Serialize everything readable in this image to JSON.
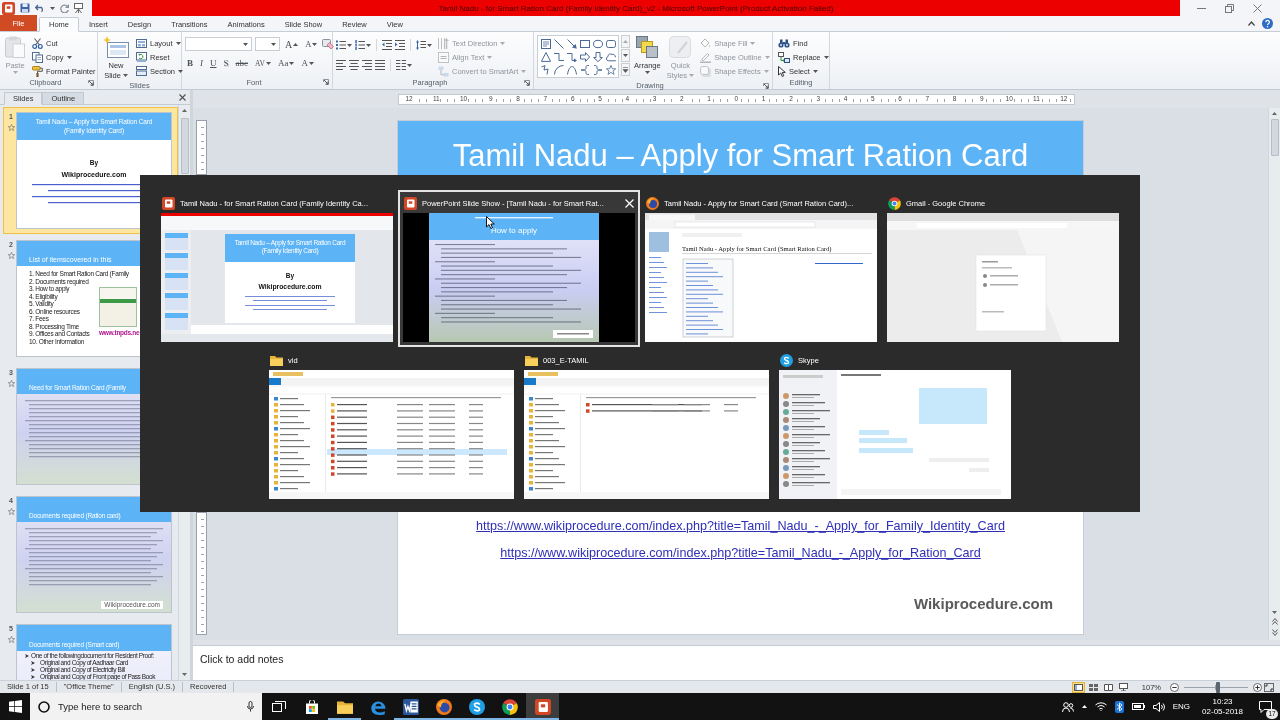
{
  "title_bar": {
    "title": "Tamil Nadu - for Smart Ration Card (Family Identity Card)_v2 - Microsoft PowerPoint (Product Activation Failed)"
  },
  "ribbon_tabs": [
    {
      "label": "File",
      "kind": "backstage",
      "selected": false
    },
    {
      "label": "Home",
      "kind": "tab",
      "selected": true
    },
    {
      "label": "Insert",
      "kind": "tab",
      "selected": false
    },
    {
      "label": "Design",
      "kind": "tab",
      "selected": false
    },
    {
      "label": "Transitions",
      "kind": "tab",
      "selected": false
    },
    {
      "label": "Animations",
      "kind": "tab",
      "selected": false
    },
    {
      "label": "Slide Show",
      "kind": "tab",
      "selected": false
    },
    {
      "label": "Review",
      "kind": "tab",
      "selected": false
    },
    {
      "label": "View",
      "kind": "tab",
      "selected": false
    }
  ],
  "ribbon_groups": [
    {
      "kind": "clipboard",
      "label": "Clipboard",
      "launcher": true,
      "large": [
        {
          "kind": "paste",
          "lines": [
            "Paste"
          ],
          "dropdown": true,
          "disabled": true
        }
      ],
      "commands": [
        {
          "kind": "cut",
          "label": "Cut",
          "dropdown": false,
          "disabled": false
        },
        {
          "kind": "copy",
          "label": "Copy",
          "dropdown": true,
          "disabled": false
        },
        {
          "kind": "painter",
          "label": "Format Painter",
          "dropdown": false,
          "disabled": false
        }
      ]
    },
    {
      "kind": "slides",
      "label": "Slides",
      "launcher": false,
      "large": [
        {
          "kind": "new-slide",
          "lines": [
            "New",
            "Slide"
          ],
          "dropdown": true,
          "disabled": false
        }
      ],
      "commands": [
        {
          "kind": "layout",
          "label": "Layout",
          "dropdown": true,
          "disabled": false
        },
        {
          "kind": "reset",
          "label": "Reset",
          "dropdown": false,
          "disabled": false
        },
        {
          "kind": "section",
          "label": "Section",
          "dropdown": true,
          "disabled": false
        }
      ]
    },
    {
      "kind": "font",
      "label": "Font",
      "launcher": true,
      "size_buttons": [
        {
          "kind": "grow",
          "label": "A"
        },
        {
          "kind": "shrink",
          "label": "A"
        }
      ],
      "format_buttons": [
        {
          "kind": "bold",
          "label": "B",
          "dropdown": false
        },
        {
          "kind": "italic",
          "label": "I",
          "dropdown": false
        },
        {
          "kind": "underline",
          "label": "U",
          "dropdown": false
        },
        {
          "kind": "shadow",
          "label": "S",
          "dropdown": false
        },
        {
          "kind": "strike",
          "label": "abc",
          "dropdown": false
        },
        {
          "kind": "spacing",
          "label": "AV",
          "dropdown": true
        },
        {
          "kind": "case",
          "label": "Aa",
          "dropdown": true
        },
        {
          "kind": "color",
          "label": "A",
          "dropdown": true
        }
      ]
    },
    {
      "kind": "paragraph",
      "label": "Paragraph",
      "launcher": true,
      "commands": [
        {
          "kind": "text-direction",
          "label": "Text Direction",
          "dropdown": true,
          "disabled": true
        },
        {
          "kind": "align-text",
          "label": "Align Text",
          "dropdown": true,
          "disabled": true
        },
        {
          "kind": "smartart",
          "label": "Convert to SmartArt",
          "dropdown": true,
          "disabled": true
        }
      ]
    },
    {
      "kind": "drawing",
      "label": "Drawing",
      "launcher": true,
      "large": [
        {
          "kind": "arrange",
          "lines": [
            "Arrange"
          ],
          "dropdown": true,
          "disabled": false
        },
        {
          "kind": "quick-styles",
          "lines": [
            "Quick",
            "Styles"
          ],
          "dropdown": true,
          "disabled": true
        }
      ],
      "commands": [
        {
          "kind": "shape-fill",
          "label": "Shape Fill",
          "dropdown": true,
          "disabled": true
        },
        {
          "kind": "shape-outline",
          "label": "Shape Outline",
          "dropdown": true,
          "disabled": true
        },
        {
          "kind": "shape-effects",
          "label": "Shape Effects",
          "dropdown": true,
          "disabled": true
        }
      ]
    },
    {
      "kind": "editing",
      "label": "Editing",
      "launcher": false,
      "commands": [
        {
          "kind": "find",
          "label": "Find",
          "dropdown": false,
          "disabled": false
        },
        {
          "kind": "replace",
          "label": "Replace",
          "dropdown": true,
          "disabled": false
        },
        {
          "kind": "select",
          "label": "Select",
          "dropdown": true,
          "disabled": false
        }
      ]
    }
  ],
  "slides_panel": {
    "tabs": [
      {
        "label": "Slides",
        "selected": true
      },
      {
        "label": "Outline",
        "selected": false
      }
    ],
    "slides": [
      {
        "number": "1",
        "selected": true,
        "kind": "title",
        "title_lines": [
          "Tamil Nadu – Apply for Smart Ration Card",
          "(Family Identity Card)"
        ],
        "by": "By",
        "site": "Wikiprocedure.com"
      },
      {
        "number": "2",
        "selected": false,
        "kind": "list",
        "title": "List of itemscovered in this",
        "items": [
          {
            "number": "1.",
            "text": "Need for Smart Ration Card (Family"
          },
          {
            "number": "2.",
            "text": "Documents required"
          },
          {
            "number": "3.",
            "text": "How to apply"
          },
          {
            "number": "4.",
            "text": "Eligibility"
          },
          {
            "number": "5.",
            "text": "Validity"
          },
          {
            "number": "6.",
            "text": "Online resources"
          },
          {
            "number": "7.",
            "text": "Fees"
          },
          {
            "number": "8.",
            "text": "Processing Time"
          },
          {
            "number": "9.",
            "text": "Offices and Contacts"
          },
          {
            "number": "10.",
            "text": "Other Information"
          }
        ],
        "link": "www.tnpds.ne"
      },
      {
        "number": "3",
        "selected": false,
        "kind": "text",
        "title": "Need for Smart Ration Card (Family"
      },
      {
        "number": "4",
        "selected": false,
        "kind": "text",
        "title": "Documents required (Ration card)",
        "footer": "Wikiprocedure.com"
      },
      {
        "number": "5",
        "selected": false,
        "kind": "bullets",
        "title": "Documents required (Smart card)",
        "bullets": [
          {
            "text": "One of the followingdocument for Resident Proof:",
            "children": [
              {
                "text": "Original and Copy of Aadhaar Card"
              },
              {
                "text": "Original and Copy of Electricity Bill"
              },
              {
                "text": "Original and Copy of Front page of Pass Book"
              }
            ]
          }
        ]
      }
    ]
  },
  "ruler": {
    "numbers": [
      "12",
      "11",
      "10",
      "9",
      "8",
      "7",
      "6",
      "5",
      "4",
      "3",
      "2",
      "1",
      "0",
      "1",
      "2",
      "3",
      "4",
      "5",
      "6",
      "7",
      "8",
      "9",
      "10",
      "11",
      "12"
    ]
  },
  "slide": {
    "title": "Tamil Nadu – Apply for Smart Ration Card",
    "links": [
      "https://www.wikiprocedure.com/index.php?title=Tamil_Nadu_-_Apply_for_Family_Identity_Card",
      "https://www.wikiprocedure.com/index.php?title=Tamil_Nadu_-_Apply_for_Ration_Card"
    ],
    "footer": "Wikiprocedure.com"
  },
  "notes": {
    "placeholder": "Click to add notes"
  },
  "status_bar": {
    "items": [
      "Slide 1 of 15",
      "\"Office Theme\"",
      "English (U.S.)",
      "Recovered"
    ],
    "views": [
      {
        "kind": "normal",
        "selected": true
      },
      {
        "kind": "sorter",
        "selected": false
      },
      {
        "kind": "reading",
        "selected": false
      },
      {
        "kind": "slideshow",
        "selected": false
      }
    ],
    "zoom": {
      "reading": "107%",
      "level": 0.53
    }
  },
  "task_switcher": {
    "rows": [
      [
        {
          "kind": "powerpoint",
          "title": "Tamil Nadu - for Smart Ration Card (Family Identity Ca...",
          "selected": false,
          "preview": {
            "kind": "editor",
            "title_lines": [
              "Tamil Nadu – Apply for Smart Ration Card",
              "(Family Identity Card)"
            ],
            "by": "By",
            "site": "Wikiprocedure.com"
          }
        },
        {
          "kind": "powerpoint",
          "title": "PowerPoint Slide Show - [Tamil Nadu - for Smart Rat...",
          "selected": true,
          "preview": {
            "kind": "slideshow",
            "title": "How to apply"
          }
        },
        {
          "kind": "firefox",
          "title": "Tamil Nadu - Apply for Smart Card (Smart Ration Card)...",
          "selected": false,
          "preview": {
            "kind": "web-page",
            "heading": "Tamil Nadu - Apply for Smart Card (Smart Ration Card)"
          }
        },
        {
          "kind": "chrome",
          "title": "Gmail - Google Chrome",
          "selected": false,
          "preview": {
            "kind": "sign-in"
          }
        }
      ],
      [
        {
          "kind": "folder",
          "title": "vid",
          "selected": false,
          "preview": {
            "kind": "file-list"
          }
        },
        {
          "kind": "folder",
          "title": "003_E-TAMIL",
          "selected": false,
          "preview": {
            "kind": "file-pair"
          }
        },
        {
          "kind": "skype",
          "title": "Skype",
          "selected": false,
          "preview": {
            "kind": "chat"
          }
        }
      ]
    ]
  },
  "taskbar": {
    "search": {
      "placeholder": "Type here to search"
    },
    "apps": [
      {
        "kind": "task-view",
        "running": false,
        "selected": false
      },
      {
        "kind": "store",
        "running": false,
        "selected": false
      },
      {
        "kind": "folder",
        "running": true,
        "selected": false
      },
      {
        "kind": "edge",
        "running": false,
        "selected": false
      },
      {
        "kind": "word",
        "running": true,
        "selected": false
      },
      {
        "kind": "firefox",
        "running": true,
        "selected": false
      },
      {
        "kind": "skype",
        "running": true,
        "selected": false
      },
      {
        "kind": "chrome",
        "running": true,
        "selected": false
      },
      {
        "kind": "powerpoint",
        "running": true,
        "selected": true
      }
    ],
    "tray": {
      "language": "ENG",
      "time": "10:23",
      "date": "02-05-2018",
      "notifications": "17"
    }
  }
}
